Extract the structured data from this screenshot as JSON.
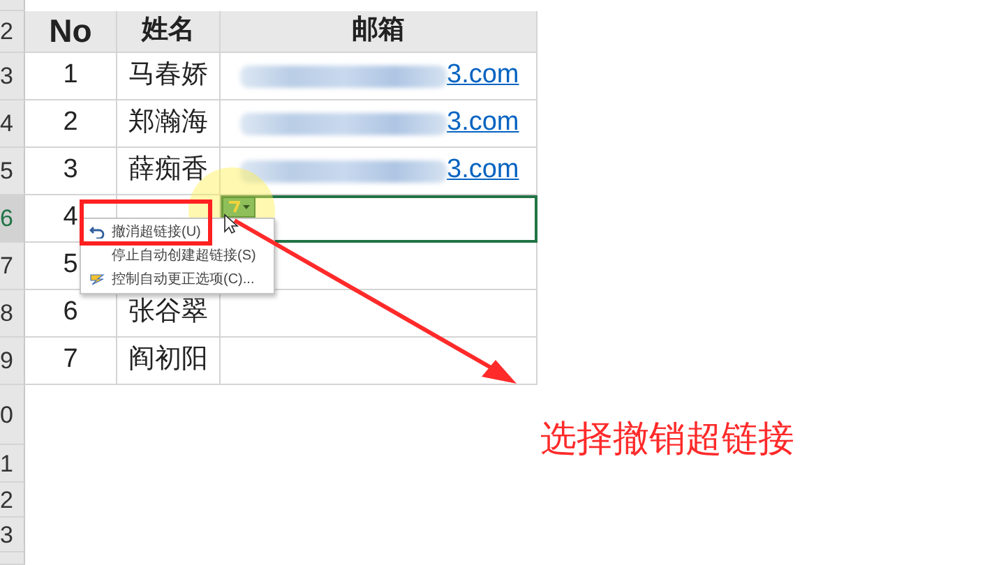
{
  "row_headers": [
    "2",
    "3",
    "4",
    "5",
    "6",
    "7",
    "8",
    "9",
    "0",
    "1",
    "2",
    "3"
  ],
  "table": {
    "columns": [
      "No",
      "姓名",
      "邮箱"
    ],
    "rows": [
      {
        "no": "1",
        "name": "马春娇",
        "email": "3.com",
        "blurred": true,
        "selected": false
      },
      {
        "no": "2",
        "name": "郑瀚海",
        "email": "3.com",
        "blurred": true,
        "selected": false
      },
      {
        "no": "3",
        "name": "薛痴香",
        "email": "3.com",
        "blurred": true,
        "selected": false
      },
      {
        "no": "4",
        "selected": true
      },
      {
        "no": "5",
        "selected": false
      },
      {
        "no": "6",
        "name": "张谷翠",
        "selected": false
      },
      {
        "no": "7",
        "name": "阎初阳",
        "selected": false
      }
    ]
  },
  "autocorrect_menu": {
    "items": [
      {
        "kind": "undo",
        "label": "撤消超链接(U)",
        "highlighted": true
      },
      {
        "kind": "plain",
        "label": "停止自动创建超链接(S)",
        "highlighted": false
      },
      {
        "kind": "options",
        "label": "控制自动更正选项(C)...",
        "highlighted": false
      }
    ]
  },
  "annotation": "选择撤销超链接"
}
